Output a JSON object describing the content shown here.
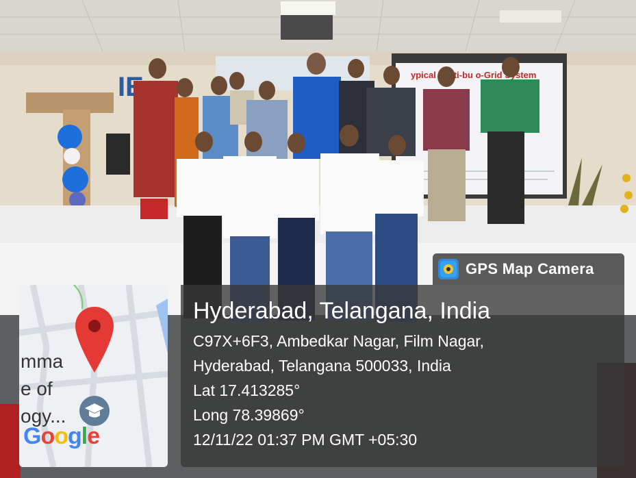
{
  "overlay": {
    "app_name": "GPS Map Camera",
    "place": "Hyderabad, Telangana, India",
    "address_line1": "C97X+6F3, Ambedkar Nagar, Film Nagar,",
    "address_line2": "Hyderabad, Telangana 500033, India",
    "lat": "Lat 17.413285°",
    "long": "Long 78.39869°",
    "timestamp": "12/11/22 01:37 PM GMT +05:30"
  },
  "map": {
    "label_line1": "mma",
    "label_line2": "e of",
    "label_line3": "ogy...",
    "logo_letters": [
      "G",
      "o",
      "o",
      "g",
      "l",
      "e"
    ],
    "logo_colors": [
      "#4285F4",
      "#EA4335",
      "#FBBC05",
      "#4285F4",
      "#34A853",
      "#EA4335"
    ],
    "pin_color": "#e53935"
  },
  "scene": {
    "screen_title": "ypical Multi-bu      o-Grid System",
    "banner_text": "IEEE"
  }
}
